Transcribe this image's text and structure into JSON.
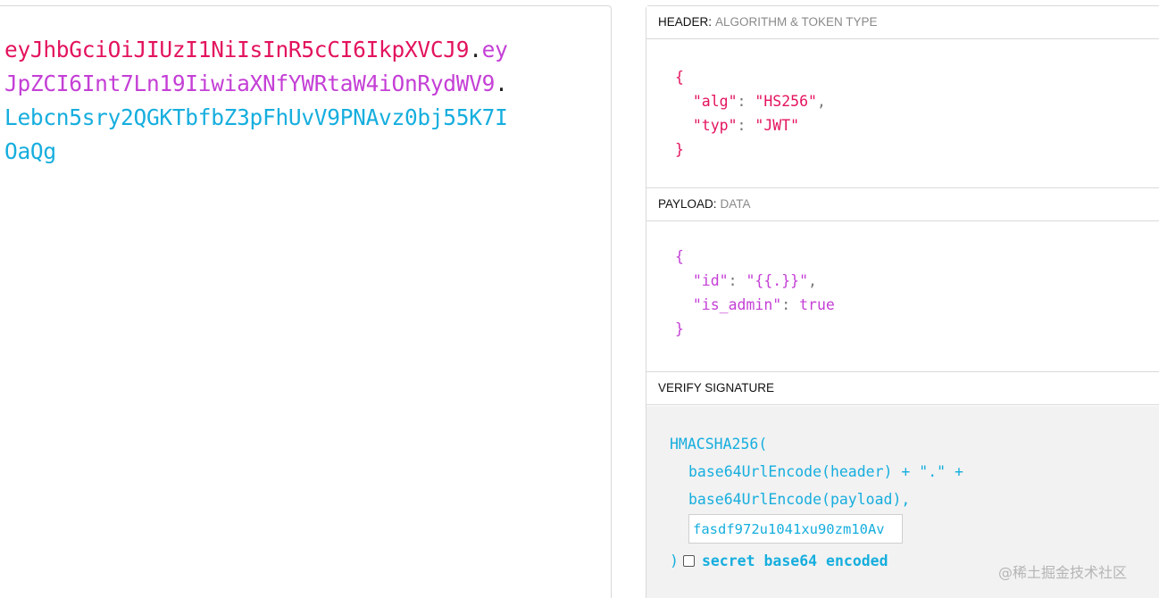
{
  "encoded": {
    "lines": [
      [
        {
          "text": "eyJhbGciOiJIUzI1NiIsInR5cCI6IkpXVCJ9",
          "part": "header"
        },
        {
          "text": ".",
          "part": "dot"
        },
        {
          "text": "ey",
          "part": "payload"
        }
      ],
      [
        {
          "text": "JpZCI6Int7Ln19IiwiaXNfYWRtaW4iOnRydWV9",
          "part": "payload"
        },
        {
          "text": ".",
          "part": "dot"
        }
      ],
      [
        {
          "text": "Lebcn5sry2QGKTbfbZ3pFhUvV9PNAvz0bj55K7I",
          "part": "signature"
        }
      ],
      [
        {
          "text": "OaQg",
          "part": "signature"
        }
      ]
    ]
  },
  "header_section": {
    "label": "HEADER:",
    "sublabel": "ALGORITHM & TOKEN TYPE",
    "open_brace": "{",
    "close_brace": "}",
    "fields": [
      {
        "key": "\"alg\"",
        "value": "\"HS256\"",
        "comma": ","
      },
      {
        "key": "\"typ\"",
        "value": "\"JWT\"",
        "comma": ""
      }
    ]
  },
  "payload_section": {
    "label": "PAYLOAD:",
    "sublabel": "DATA",
    "open_brace": "{",
    "close_brace": "}",
    "fields": [
      {
        "key": "\"id\"",
        "value": "\"{{.}}\"",
        "comma": ","
      },
      {
        "key": "\"is_admin\"",
        "value": "true",
        "comma": ""
      }
    ]
  },
  "verify_section": {
    "label": "VERIFY SIGNATURE",
    "fn_open": "HMACSHA256(",
    "line1": "base64UrlEncode(header) + \".\" +",
    "line2": "base64UrlEncode(payload),",
    "secret_value": "fasdf972u1041xu90zm10Av",
    "close_paren": ")",
    "checkbox_label": "secret base64 encoded",
    "checkbox_checked": false
  },
  "watermark": "@稀土掘金技术社区",
  "colors": {
    "header": "#e3135e",
    "payload": "#c43fd6",
    "signature": "#16aede"
  }
}
